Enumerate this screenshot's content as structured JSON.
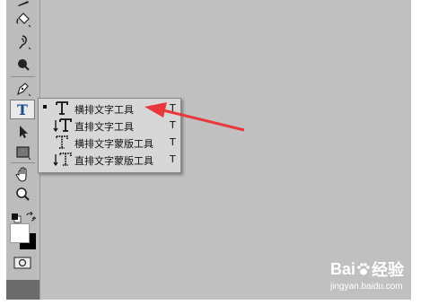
{
  "toolbar": {
    "tools": [
      {
        "name": "brush-icon"
      },
      {
        "name": "paint-bucket-icon"
      },
      {
        "name": "burn-tool-icon"
      },
      {
        "name": "magnifier-dot-icon"
      },
      {
        "name": "pen-tool-icon"
      },
      {
        "name": "type-tool-icon",
        "label": "T",
        "active": true
      },
      {
        "name": "path-selection-icon"
      },
      {
        "name": "rectangle-tool-icon"
      },
      {
        "name": "hand-tool-icon"
      },
      {
        "name": "zoom-tool-icon"
      },
      {
        "name": "default-colors-icon"
      },
      {
        "name": "swap-colors-icon"
      },
      {
        "name": "color-swatches-icon"
      },
      {
        "name": "quick-mask-icon"
      }
    ]
  },
  "flyout_menu": {
    "items": [
      {
        "label": "横排文字工具",
        "shortcut": "T",
        "icon": "horizontal-type-icon",
        "selected": true
      },
      {
        "label": "直排文字工具",
        "shortcut": "T",
        "icon": "vertical-type-icon",
        "selected": false
      },
      {
        "label": "横排文字蒙版工具",
        "shortcut": "T",
        "icon": "horizontal-type-mask-icon",
        "selected": false
      },
      {
        "label": "直排文字蒙版工具",
        "shortcut": "T",
        "icon": "vertical-type-mask-icon",
        "selected": false
      }
    ]
  },
  "annotation": {
    "arrow_color": "#e8383b"
  },
  "watermark": {
    "brand_left": "Bai",
    "brand_right": "经验",
    "url": "jingyan.baidu.com"
  },
  "colors": {
    "canvas": "#c0c0c0",
    "toolbar": "#bcbcbc",
    "menu": "#d7d7d7",
    "type_icon_blue": "#1f4a8a"
  }
}
